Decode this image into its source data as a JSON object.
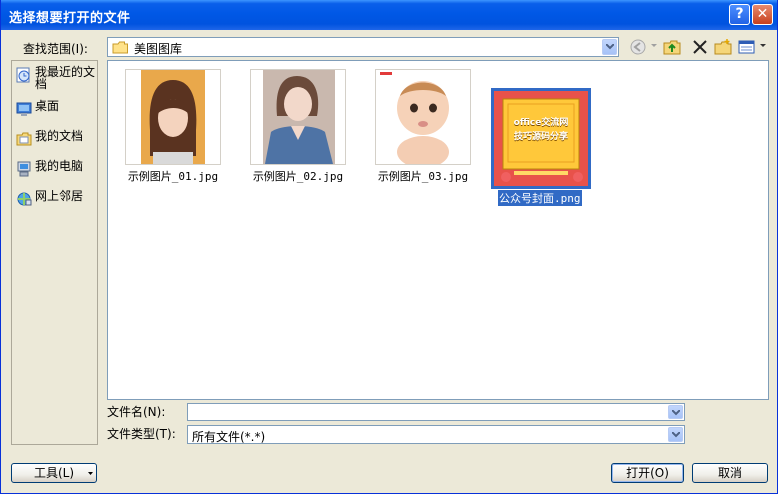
{
  "window": {
    "title": "选择想要打开的文件"
  },
  "lookin": {
    "label": "查找范围(I):",
    "value": "美图图库"
  },
  "places": [
    {
      "label": "我最近的文档",
      "icon": "recent-docs-icon"
    },
    {
      "label": "桌面",
      "icon": "desktop-icon"
    },
    {
      "label": "我的文档",
      "icon": "my-documents-icon"
    },
    {
      "label": "我的电脑",
      "icon": "my-computer-icon"
    },
    {
      "label": "网上邻居",
      "icon": "network-places-icon"
    }
  ],
  "files": [
    {
      "name": "示例图片_01.jpg"
    },
    {
      "name": "示例图片_02.jpg"
    },
    {
      "name": "示例图片_03.jpg"
    },
    {
      "name": "公众号封面.png",
      "selected": true,
      "cover_text_1": "office交流网",
      "cover_text_2": "技巧源码分享"
    }
  ],
  "filename": {
    "label": "文件名(N):",
    "value": ""
  },
  "filetype": {
    "label": "文件类型(T):",
    "value": "所有文件(*.*)"
  },
  "buttons": {
    "tools": "工具(L)",
    "open": "打开(O)",
    "cancel": "取消"
  },
  "colors": {
    "titlebar": "#0058E6",
    "selection": "#316AC5",
    "cover_bg": "#E8524A",
    "cover_card": "#FFC83A"
  }
}
